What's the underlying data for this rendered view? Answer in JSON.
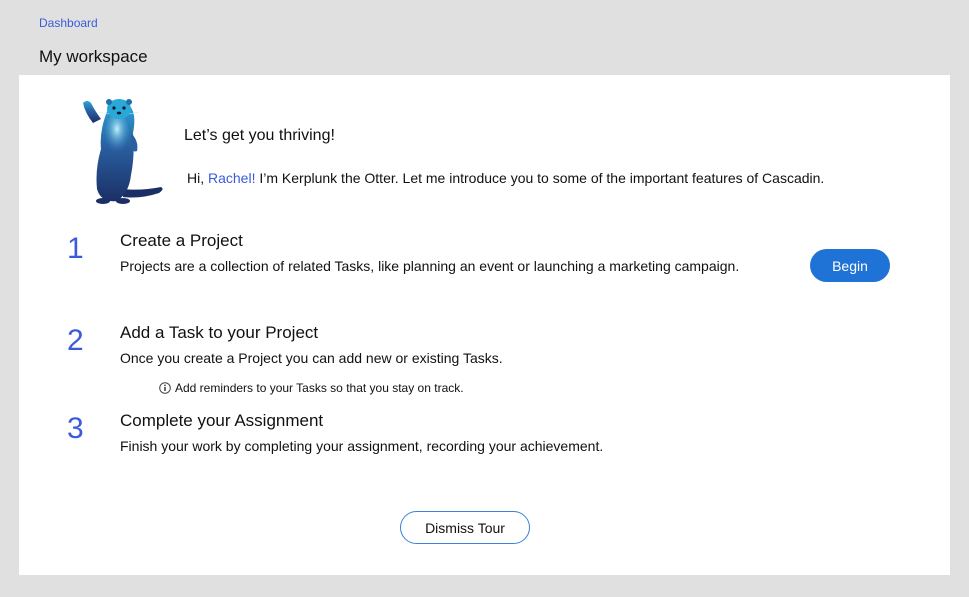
{
  "breadcrumb": {
    "label": "Dashboard"
  },
  "page": {
    "title": "My workspace"
  },
  "tour": {
    "headline": "Let’s get you thriving!",
    "greeting_prefix": "Hi, ",
    "username": "Rachel!",
    "greeting_suffix": " I’m Kerplunk the Otter. Let me introduce you to some of the important features of Cascadin.",
    "steps": [
      {
        "number": "1",
        "title": "Create a Project",
        "description": "Projects are a collection of related Tasks, like planning an event or launching a marketing campaign."
      },
      {
        "number": "2",
        "title": "Add a Task to your Project",
        "description": "Once you create a Project you can add new or existing Tasks."
      },
      {
        "number": "3",
        "title": "Complete your Assignment",
        "description": "Finish your work by completing your assignment, recording your achievement."
      }
    ],
    "begin_label": "Begin",
    "tip": "Add reminders to your Tasks so that you stay on track.",
    "dismiss_label": "Dismiss Tour"
  },
  "colors": {
    "accent": "#3b5bdb",
    "primary_button": "#1f73d6",
    "background": "#e0e0e0",
    "card": "#ffffff"
  },
  "icons": {
    "mascot": "otter-mascot-icon",
    "tip": "info-icon"
  }
}
